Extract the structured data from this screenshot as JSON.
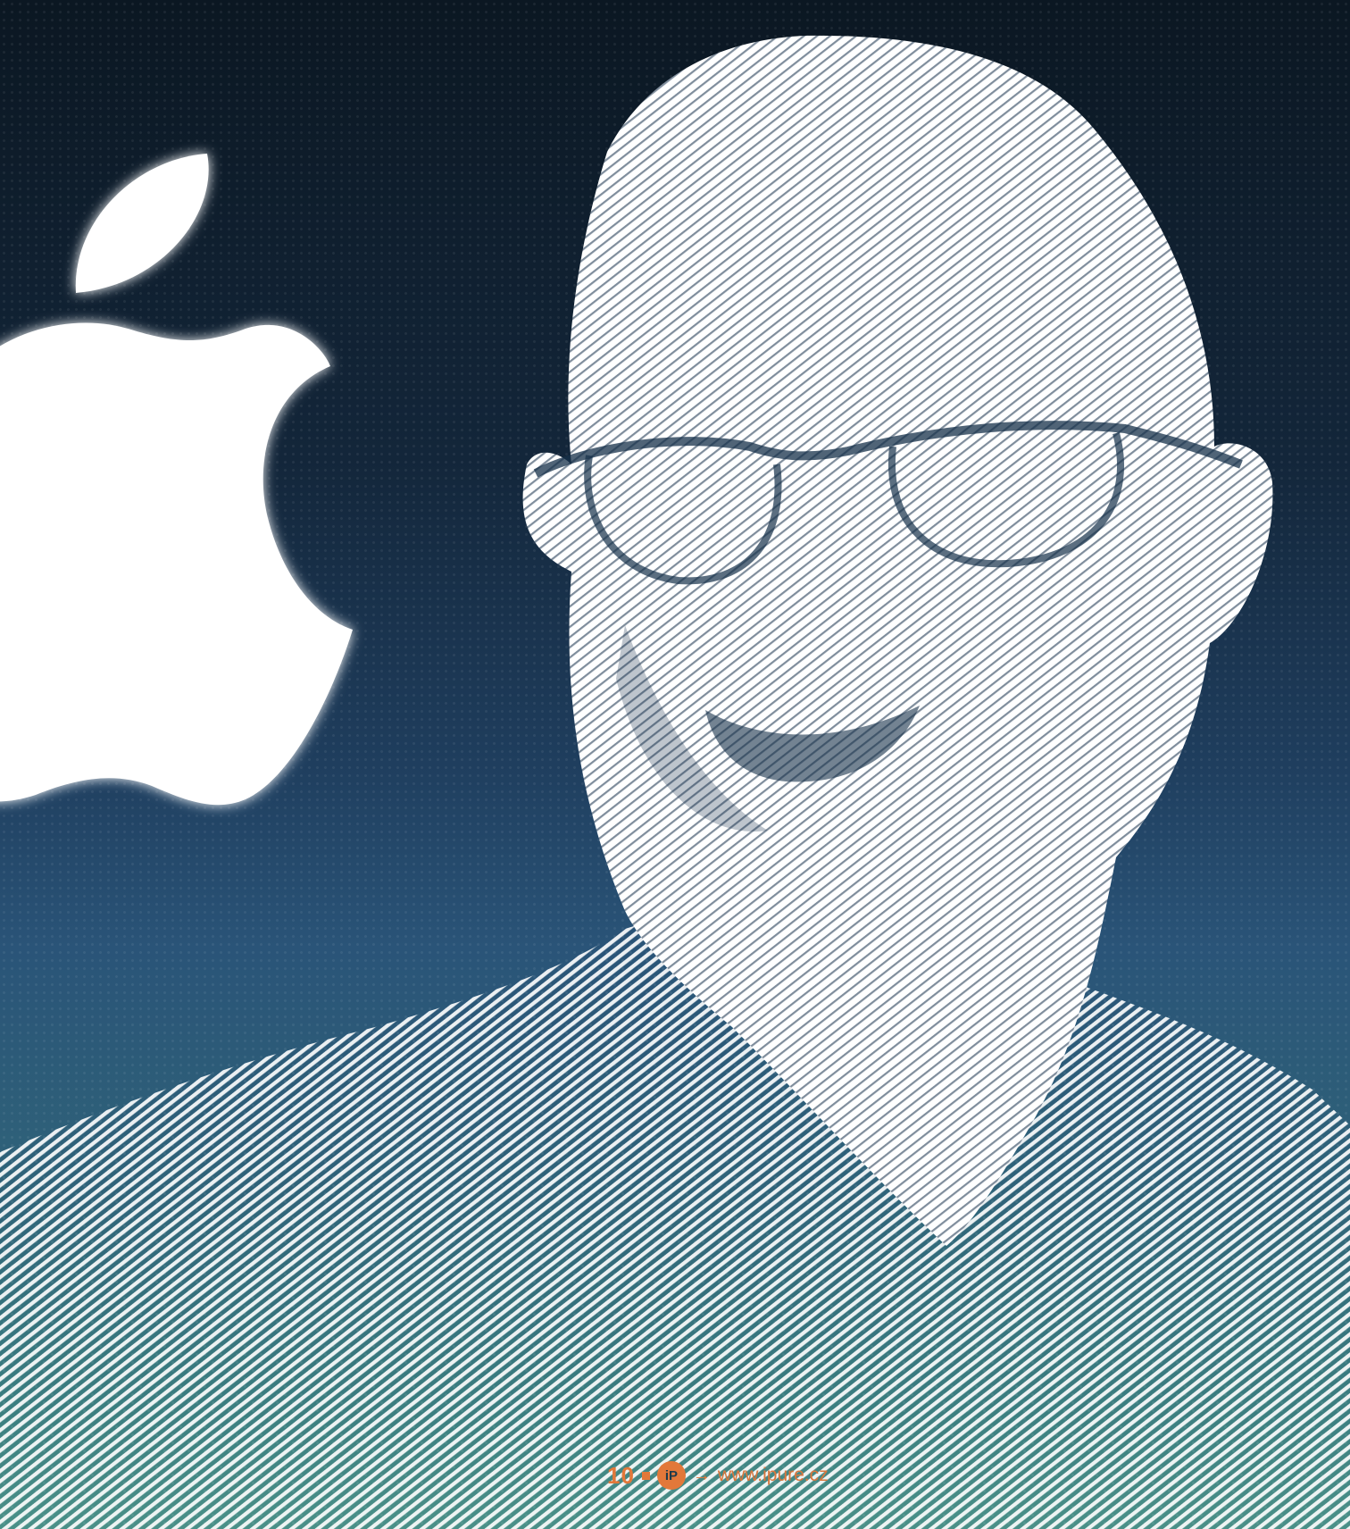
{
  "footer": {
    "page_number": "10",
    "logo_text": "iP",
    "arrow": "→",
    "url": "www.ipure.cz"
  },
  "colors": {
    "accent": "#e2783a",
    "background_top": "#0b1722",
    "background_bottom": "#4a9088",
    "figure": "#ffffff"
  },
  "icons": {
    "logo": "apple-logo-icon",
    "portrait": "halftone-portrait"
  }
}
